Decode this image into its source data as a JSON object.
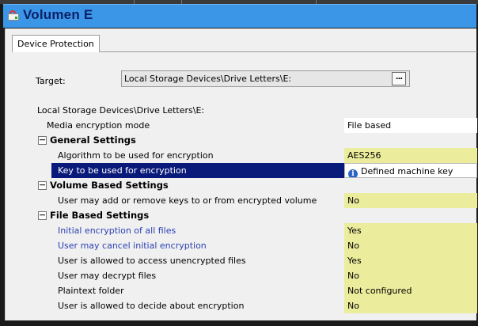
{
  "window": {
    "title": "Volumen  E"
  },
  "tabs": [
    {
      "label": "Device Protection"
    }
  ],
  "target": {
    "label": "Target:",
    "value": "Local Storage Devices\\Drive Letters\\E:",
    "browse_label": "..."
  },
  "settings": {
    "path": "Local Storage Devices\\Drive Letters\\E:",
    "media_mode": {
      "name": "Media encryption mode",
      "value": "File based"
    },
    "general": {
      "title": "General Settings",
      "rows": [
        {
          "name": "Algorithm to be used for encryption",
          "value": "AES256"
        },
        {
          "name": "Key to be used for encryption",
          "value": "Defined machine key"
        }
      ]
    },
    "volume": {
      "title": "Volume Based Settings",
      "rows": [
        {
          "name": "User may add or remove keys to or from encrypted volume",
          "value": "No"
        }
      ]
    },
    "file": {
      "title": "File Based Settings",
      "rows": [
        {
          "name": "Initial encryption of all files",
          "value": "Yes"
        },
        {
          "name": "User may cancel initial encryption",
          "value": "No"
        },
        {
          "name": "User is allowed to access unencrypted files",
          "value": "Yes"
        },
        {
          "name": "User may decrypt files",
          "value": "No"
        },
        {
          "name": "Plaintext folder",
          "value": "Not configured"
        },
        {
          "name": "User is allowed to decide about encryption",
          "value": "No"
        }
      ]
    }
  },
  "icons": {
    "window": "drive-lock-icon",
    "info": "info-icon",
    "expander": "collapse-icon"
  },
  "colors": {
    "header": "#3b96e8",
    "selection": "#0a1a7a",
    "value_cell": "#ecec9d",
    "link_text": "#2a3fb3"
  }
}
